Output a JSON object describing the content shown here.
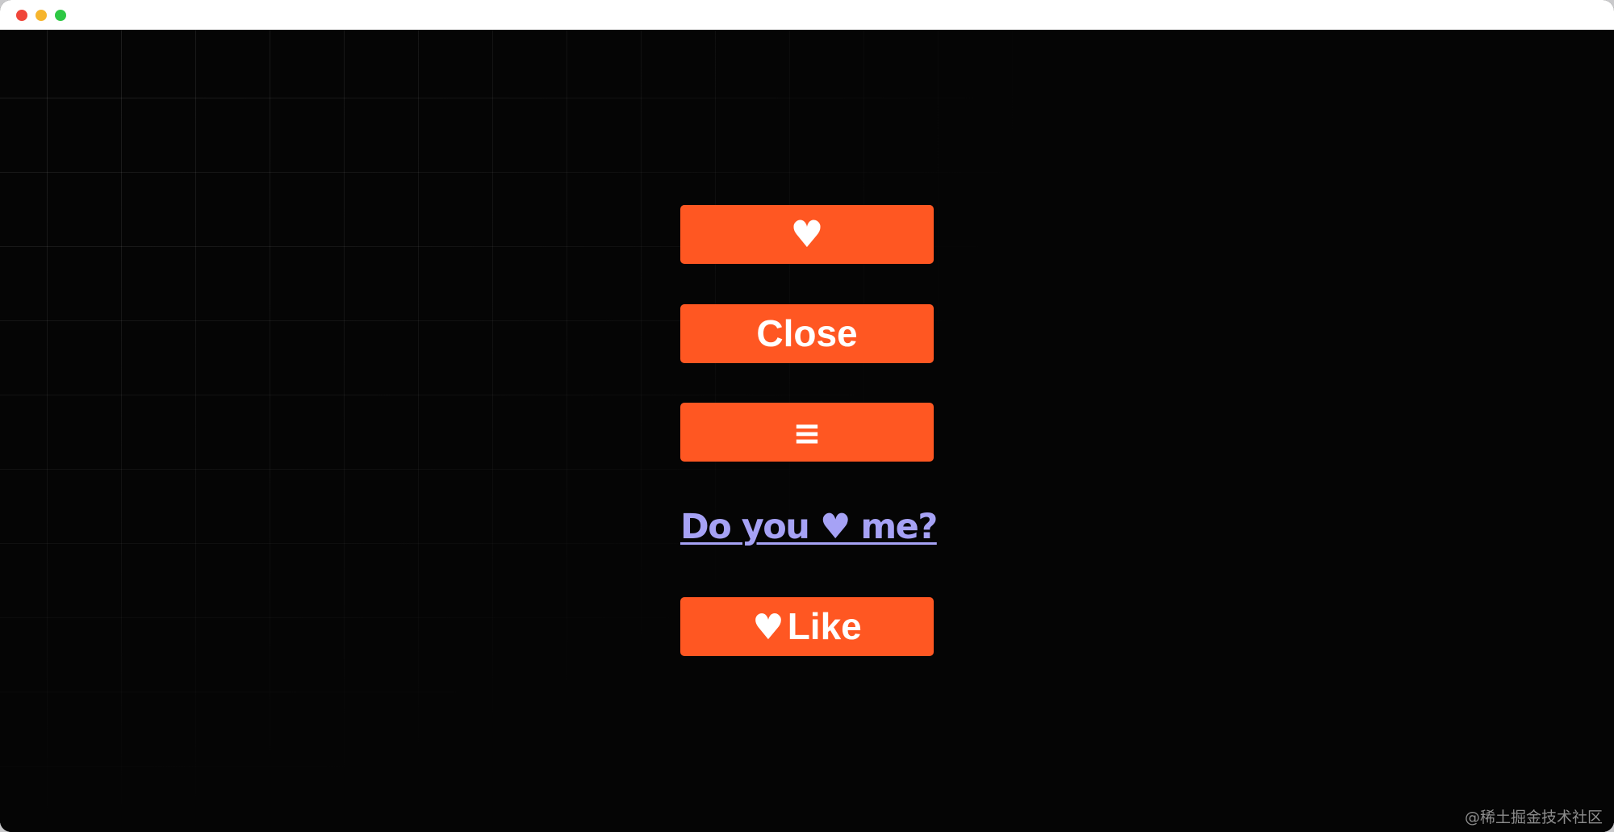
{
  "window": {
    "controls": [
      "close",
      "minimize",
      "maximize"
    ]
  },
  "buttons": {
    "heart": "♥",
    "close": "Close",
    "menu": "≡",
    "like_icon": "♥",
    "like_label": "Like"
  },
  "link": {
    "text": "Do you ♥ me?"
  },
  "watermark": "@稀土掘金技术社区",
  "colors": {
    "button_bg": "#ff5722",
    "button_text": "#ffffff",
    "link": "#a6a2f5",
    "background": "#050505"
  },
  "icons": [
    "heart-icon",
    "menu-icon"
  ]
}
